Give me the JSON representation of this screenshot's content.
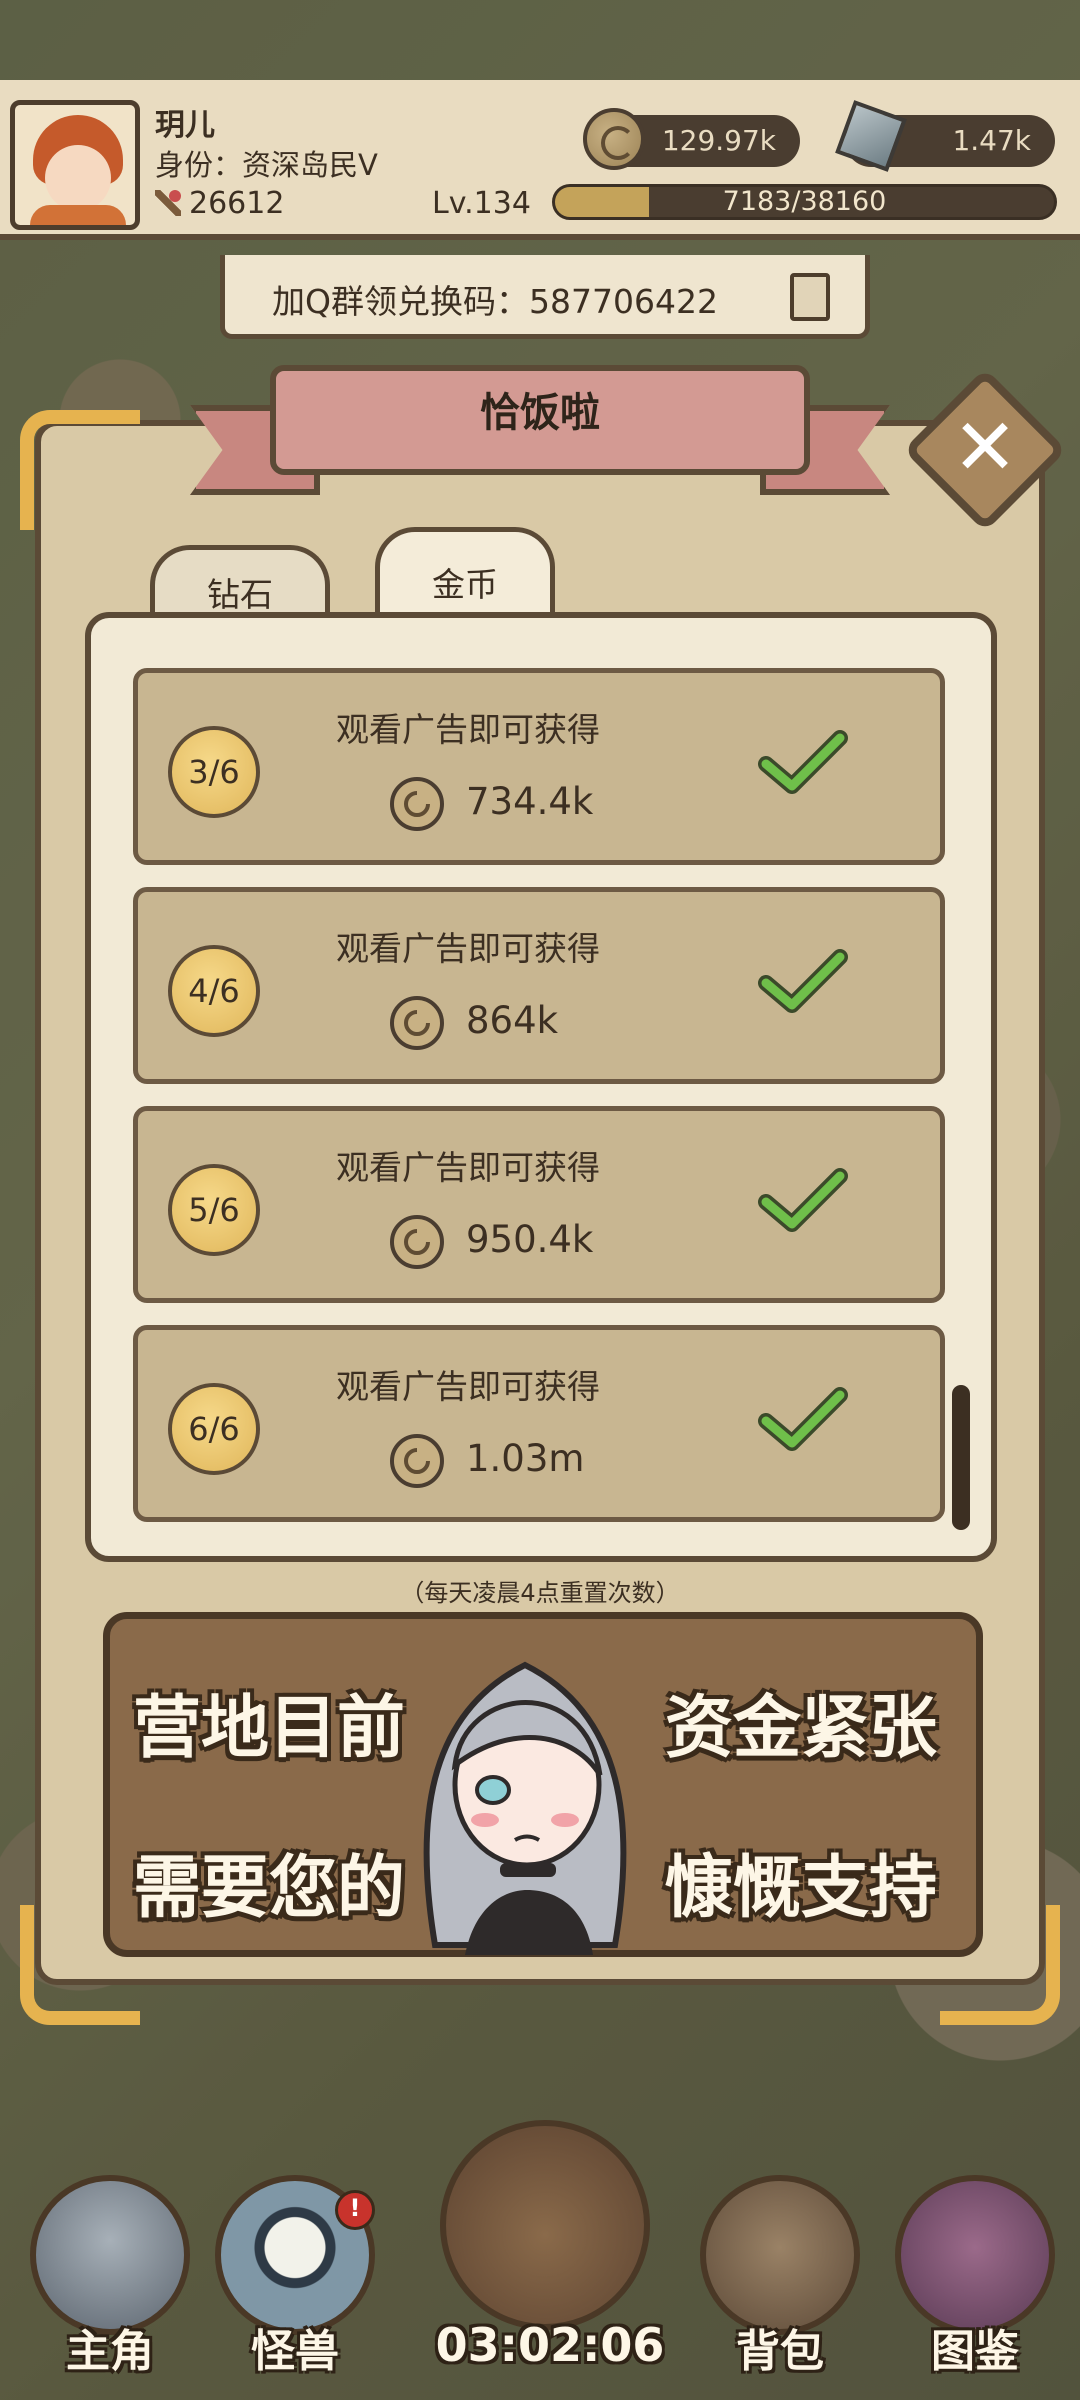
{
  "player": {
    "name": "玥儿",
    "status": "身份：资深岛民Ⅴ",
    "power": "26612",
    "level": "Lv.134",
    "xp_text": "7183/38160",
    "xp_progress": 0.188
  },
  "resources": {
    "coins": "129.97k",
    "gems": "1.47k"
  },
  "code_bar": {
    "text": "加Q群领兑换码：587706422"
  },
  "dialog": {
    "title": "恰饭啦",
    "close_symbol": "✕",
    "tabs": [
      {
        "label": "钻石",
        "selected": false
      },
      {
        "label": "金币",
        "selected": true
      }
    ],
    "rows": [
      {
        "progress": "3/6",
        "label": "观看广告即可获得",
        "reward": "734.4k",
        "completed": true
      },
      {
        "progress": "4/6",
        "label": "观看广告即可获得",
        "reward": "864k",
        "completed": true
      },
      {
        "progress": "5/6",
        "label": "观看广告即可获得",
        "reward": "950.4k",
        "completed": true
      },
      {
        "progress": "6/6",
        "label": "观看广告即可获得",
        "reward": "1.03m",
        "completed": true
      }
    ],
    "reset_note": "（每天凌晨4点重置次数）",
    "banner": {
      "line1_left": "营地目前",
      "line1_right": "资金紧张",
      "line2_left": "需要您的",
      "line2_right": "慷慨支持"
    }
  },
  "nav": {
    "items": [
      {
        "label": "主角",
        "icon": "helmet-icon"
      },
      {
        "label": "怪兽",
        "icon": "monster-icon",
        "alert": "!"
      },
      {
        "label": "",
        "icon": "ship-icon"
      },
      {
        "label": "背包",
        "icon": "backpack-icon"
      },
      {
        "label": "图鉴",
        "icon": "book-icon"
      }
    ],
    "timer": "03:02:06"
  },
  "colors": {
    "panel": "#d9c9a6",
    "border": "#5b4a36",
    "accent_gold": "#e6b34f",
    "check_green": "#6fbf4a",
    "ribbon": "#d39a93"
  }
}
